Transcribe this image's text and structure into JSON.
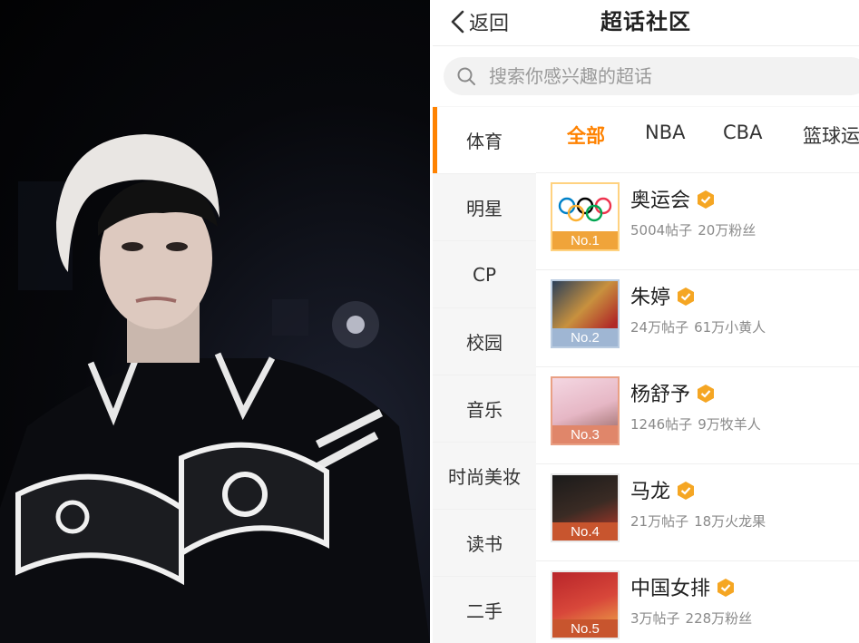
{
  "nav": {
    "back_label": "返回",
    "title": "超话社区"
  },
  "search": {
    "placeholder": "搜索你感兴趣的超话"
  },
  "categories": [
    {
      "label": "体育",
      "active": true
    },
    {
      "label": "明星",
      "active": false
    },
    {
      "label": "CP",
      "active": false
    },
    {
      "label": "校园",
      "active": false
    },
    {
      "label": "音乐",
      "active": false
    },
    {
      "label": "时尚美妆",
      "active": false
    },
    {
      "label": "读书",
      "active": false
    },
    {
      "label": "二手",
      "active": false
    }
  ],
  "tabs": [
    {
      "label": "全部",
      "active": true
    },
    {
      "label": "NBA",
      "active": false
    },
    {
      "label": "CBA",
      "active": false
    },
    {
      "label": "篮球运",
      "active": false
    }
  ],
  "ranking": [
    {
      "rank": "No.1",
      "name": "奥运会",
      "posts": "5004帖子",
      "fans": "20万粉丝",
      "thumb": "olympic-rings"
    },
    {
      "rank": "No.2",
      "name": "朱婷",
      "posts": "24万帖子",
      "fans": "61万小黄人",
      "thumb": "athlete"
    },
    {
      "rank": "No.3",
      "name": "杨舒予",
      "posts": "1246帖子",
      "fans": "9万牧羊人",
      "thumb": "athlete"
    },
    {
      "rank": "No.4",
      "name": "马龙",
      "posts": "21万帖子",
      "fans": "18万火龙果",
      "thumb": "athlete"
    },
    {
      "rank": "No.5",
      "name": "中国女排",
      "posts": "3万帖子",
      "fans": "228万粉丝",
      "thumb": "team"
    }
  ],
  "colors": {
    "accent": "#ff8200",
    "badge": "#f5a623"
  }
}
